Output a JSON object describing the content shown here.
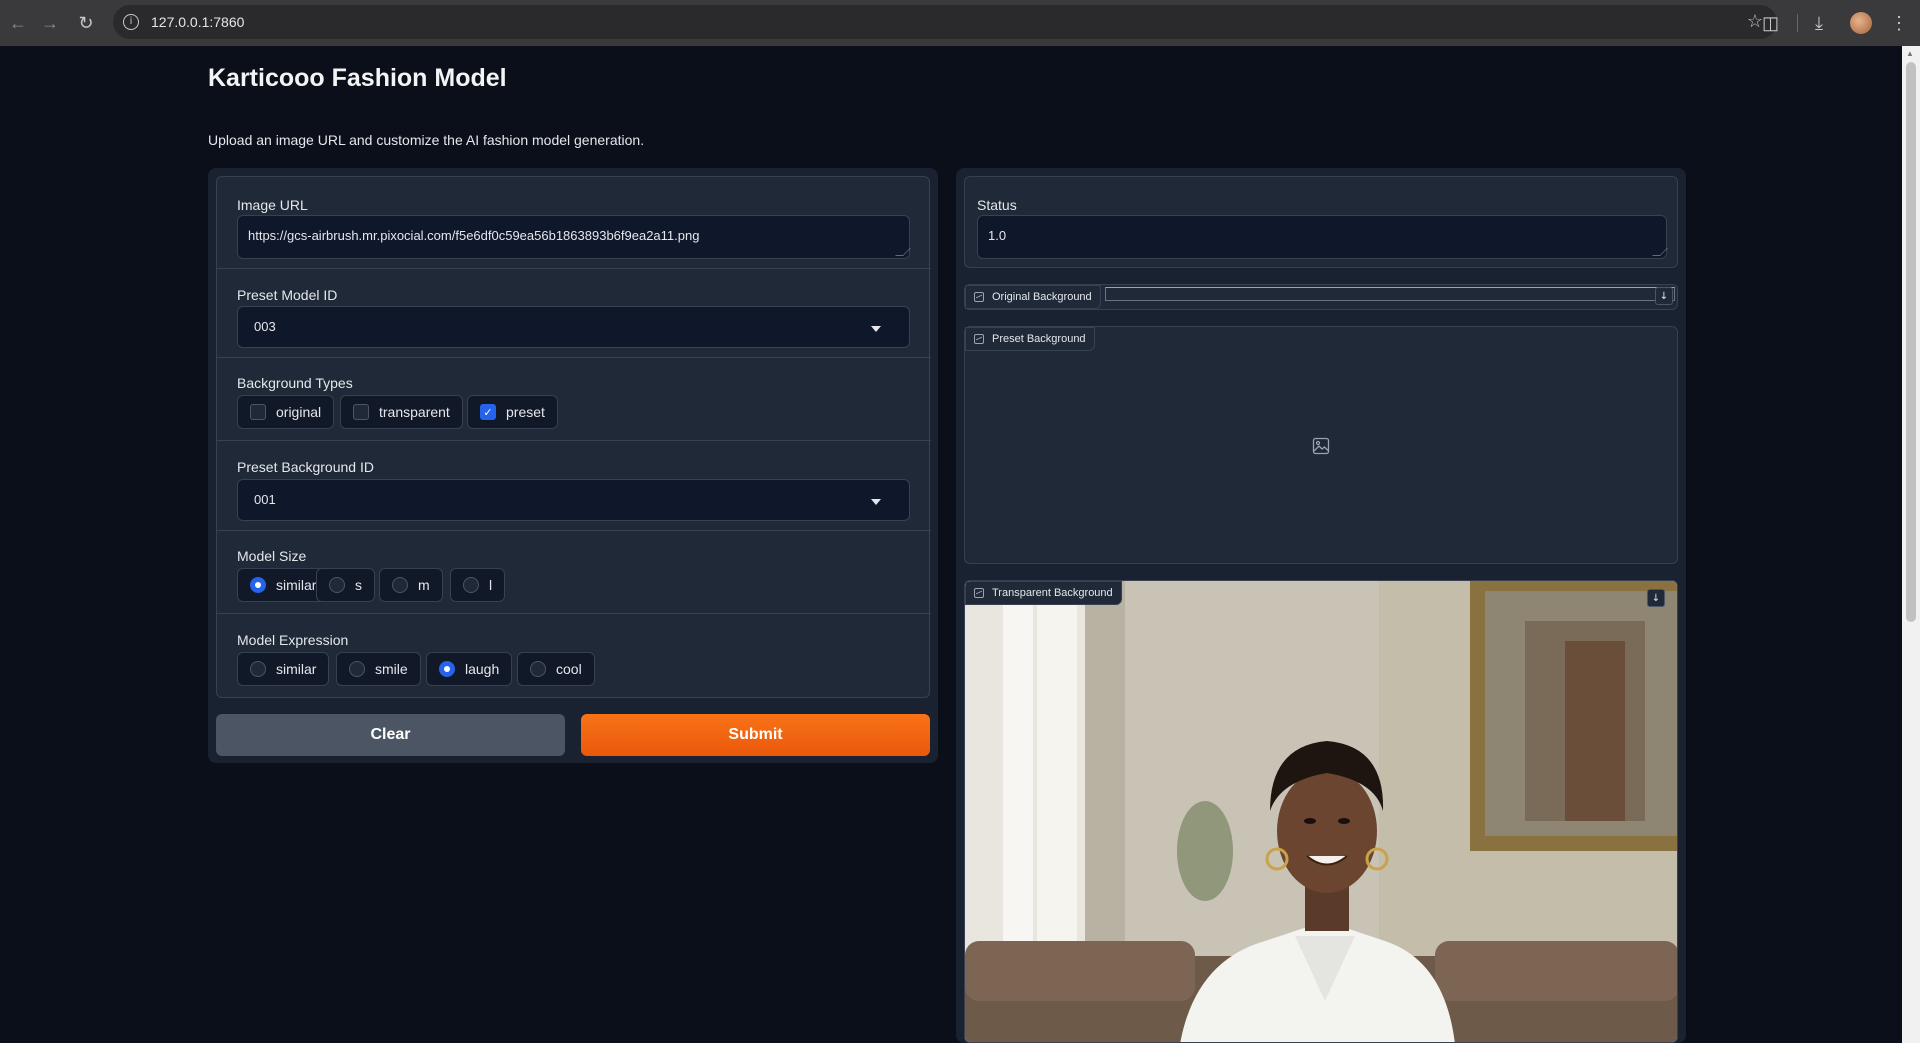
{
  "browser": {
    "url": "127.0.0.1:7860"
  },
  "app": {
    "title": "Karticooo Fashion Model",
    "description": "Upload an image URL and customize the AI fashion model generation."
  },
  "inputs": {
    "image_url": {
      "label": "Image URL",
      "value": "https://gcs-airbrush.mr.pixocial.com/f5e6df0c59ea56b1863893b6f9ea2a11.png"
    },
    "preset_model_id": {
      "label": "Preset Model ID",
      "value": "003"
    },
    "background_types": {
      "label": "Background Types",
      "options": [
        {
          "label": "original",
          "checked": false
        },
        {
          "label": "transparent",
          "checked": false
        },
        {
          "label": "preset",
          "checked": true
        }
      ]
    },
    "preset_background_id": {
      "label": "Preset Background ID",
      "value": "001"
    },
    "model_size": {
      "label": "Model Size",
      "options": [
        "similar",
        "s",
        "m",
        "l"
      ],
      "selected": "similar"
    },
    "model_expression": {
      "label": "Model Expression",
      "options": [
        "similar",
        "smile",
        "laugh",
        "cool"
      ],
      "selected": "laugh"
    }
  },
  "buttons": {
    "clear": "Clear",
    "submit": "Submit"
  },
  "outputs": {
    "status": {
      "label": "Status",
      "value": "1.0"
    },
    "original_background": {
      "label": "Original Background"
    },
    "preset_background": {
      "label": "Preset Background"
    },
    "transparent_background": {
      "label": "Transparent Background"
    }
  },
  "icons": {
    "image": "image-icon",
    "download": "download-icon",
    "empty_image": "image-placeholder-icon"
  },
  "colors": {
    "background": "#0b0f19",
    "block": "#1f2937",
    "accent": "#2563eb",
    "submit": "#f97316",
    "clear": "#4b5563"
  }
}
